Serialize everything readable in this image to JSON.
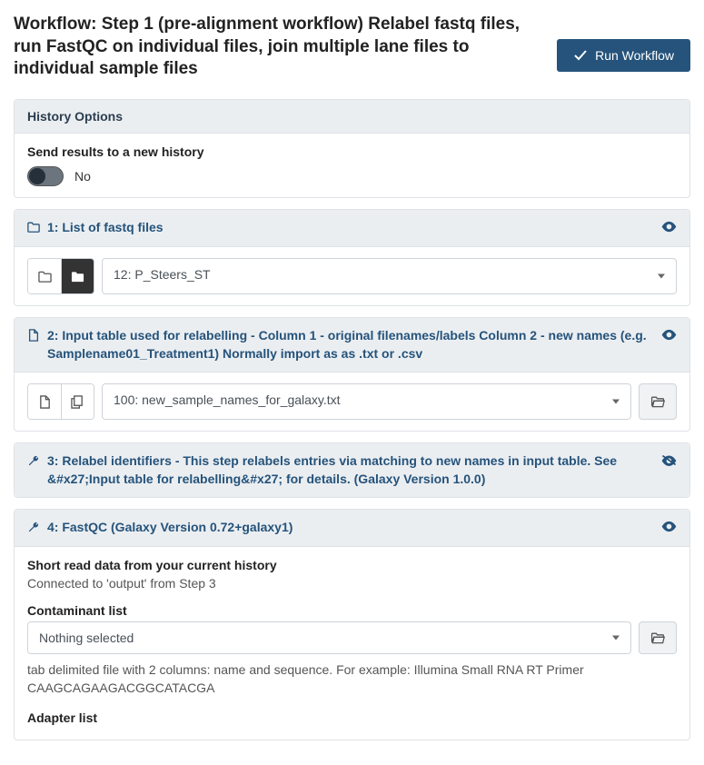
{
  "title": "Workflow: Step 1 (pre-alignment workflow) Relabel fastq files, run FastQC on individual files, join multiple lane files to individual sample files",
  "run_button": "Run Workflow",
  "history_options": {
    "header": "History Options",
    "send_label": "Send results to a new history",
    "toggle_value": "No"
  },
  "step1": {
    "header": "1: List of fastq files",
    "value": "12: P_Steers_ST"
  },
  "step2": {
    "header": "2: Input table used for relabelling - Column 1 - original filenames/labels Column 2 - new names (e.g. Samplename01_Treatment1) Normally import as as .txt or .csv",
    "value": "100: new_sample_names_for_galaxy.txt"
  },
  "step3": {
    "header": "3: Relabel identifiers - This step relabels entries via matching to new names in input table. See &#x27;Input table for relabelling&#x27; for details. (Galaxy Version 1.0.0)"
  },
  "step4": {
    "header": "4: FastQC (Galaxy Version 0.72+galaxy1)",
    "short_read_label": "Short read data from your current history",
    "connected": "Connected to 'output' from Step 3",
    "contaminant_label": "Contaminant list",
    "contaminant_value": "Nothing selected",
    "contaminant_help": "tab delimited file with 2 columns: name and sequence. For example: Illumina Small RNA RT Primer CAAGCAGAAGACGGCATACGA",
    "adapter_label": "Adapter list"
  }
}
